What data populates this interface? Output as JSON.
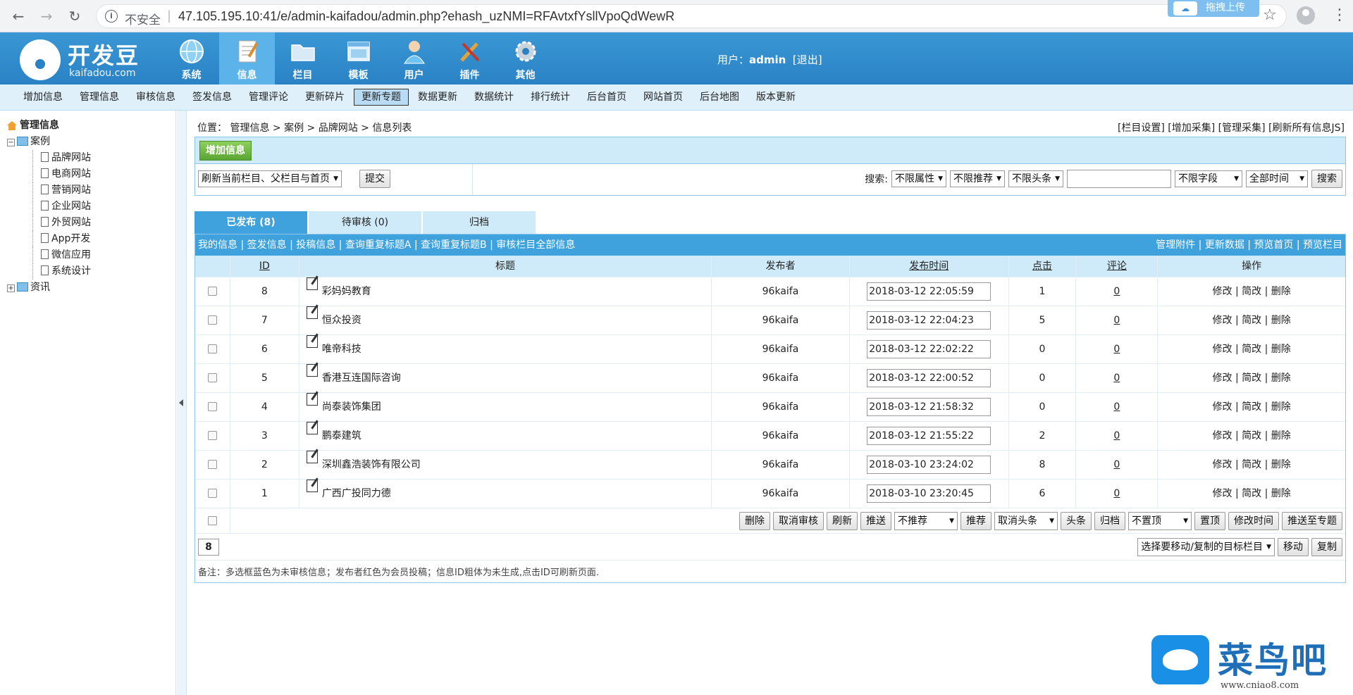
{
  "browser": {
    "insecure": "不安全",
    "url": "47.105.195.10:41/e/admin-kaifadou/admin.php?ehash_uzNMI=RFAvtxfYsllVpoQdWewR",
    "upload": "拖拽上传"
  },
  "header": {
    "logo_title": "开发豆",
    "logo_sub": "kaifadou.com",
    "modules": [
      {
        "label": "系统",
        "icon": "globe-icon"
      },
      {
        "label": "信息",
        "icon": "notepad-icon"
      },
      {
        "label": "栏目",
        "icon": "folder-icon"
      },
      {
        "label": "模板",
        "icon": "window-icon"
      },
      {
        "label": "用户",
        "icon": "user-icon"
      },
      {
        "label": "插件",
        "icon": "tools-icon"
      },
      {
        "label": "其他",
        "icon": "gear-icon"
      }
    ],
    "user_prefix": "用户：",
    "user_name": "admin",
    "logout": "[退出]"
  },
  "quicknav": [
    "增加信息",
    "管理信息",
    "审核信息",
    "签发信息",
    "管理评论",
    "更新碎片",
    "更新专题",
    "数据更新",
    "数据统计",
    "排行统计",
    "后台首页",
    "网站首页",
    "后台地图",
    "版本更新"
  ],
  "sidebar": {
    "root": "管理信息",
    "folder": "案例",
    "leaves": [
      "品牌网站",
      "电商网站",
      "营销网站",
      "企业网站",
      "外贸网站",
      "App开发",
      "微信应用",
      "系统设计"
    ],
    "folder2": "资讯"
  },
  "main": {
    "crumbs": "位置： 管理信息 > 案例 > 品牌网站 > 信息列表",
    "top_links": "[栏目设置] [增加采集] [管理采集] [刷新所有信息JS]",
    "add_btn": "增加信息",
    "refresh_select": "刷新当前栏目、父栏目与首页",
    "submit": "提交",
    "search_label": "搜索:",
    "filters": [
      "不限属性",
      "不限推荐",
      "不限头条"
    ],
    "field_select": "不限字段",
    "time_select": "全部时间",
    "search_btn": "搜索",
    "tabs": [
      "已发布 (8)",
      "待审核 (0)",
      "归档"
    ],
    "subbar_left": "我的信息 | 签发信息 | 投稿信息 | 查询重复标题A | 查询重复标题B | 审核栏目全部信息",
    "subbar_right": "管理附件 | 更新数据 | 预览首页 | 预览栏目",
    "columns": {
      "id": "ID",
      "title": "标题",
      "publisher": "发布者",
      "time": "发布时间",
      "clicks": "点击",
      "comments": "评论",
      "ops": "操作"
    },
    "ops_text": "修改 | 简改 | 删除",
    "rows": [
      {
        "id": "8",
        "title": "彩妈妈教育",
        "publisher": "96kaifa",
        "time": "2018-03-12 22:05:59",
        "clicks": "1",
        "comments": "0"
      },
      {
        "id": "7",
        "title": "恒众投资",
        "publisher": "96kaifa",
        "time": "2018-03-12 22:04:23",
        "clicks": "5",
        "comments": "0"
      },
      {
        "id": "6",
        "title": "唯帝科技",
        "publisher": "96kaifa",
        "time": "2018-03-12 22:02:22",
        "clicks": "0",
        "comments": "0"
      },
      {
        "id": "5",
        "title": "香港互连国际咨询",
        "publisher": "96kaifa",
        "time": "2018-03-12 22:00:52",
        "clicks": "0",
        "comments": "0"
      },
      {
        "id": "4",
        "title": "尚泰装饰集团",
        "publisher": "96kaifa",
        "time": "2018-03-12 21:58:32",
        "clicks": "0",
        "comments": "0"
      },
      {
        "id": "3",
        "title": "鹏泰建筑",
        "publisher": "96kaifa",
        "time": "2018-03-12 21:55:22",
        "clicks": "2",
        "comments": "0"
      },
      {
        "id": "2",
        "title": "深圳鑫浩装饰有限公司",
        "publisher": "96kaifa",
        "time": "2018-03-10 23:24:02",
        "clicks": "8",
        "comments": "0"
      },
      {
        "id": "1",
        "title": "广西广投同力德",
        "publisher": "96kaifa",
        "time": "2018-03-10 23:20:45",
        "clicks": "6",
        "comments": "0"
      }
    ],
    "actions": [
      "删除",
      "取消审核",
      "刷新",
      "推送"
    ],
    "recommend_select": "不推荐",
    "recommend_btn": "推荐",
    "headline_select": "取消头条",
    "actions2": [
      "头条",
      "归档"
    ],
    "top_select": "不置顶",
    "actions3": [
      "置顶",
      "修改时间",
      "推送至专题"
    ],
    "page_num": "8",
    "target_select": "选择要移动/复制的目标栏目",
    "move_btn": "移动",
    "copy_btn": "复制",
    "note": "备注：多选框蓝色为未审核信息；发布者红色为会员投稿；信息ID粗体为未生成,点击ID可刷新页面."
  },
  "watermark": {
    "text": "菜鸟吧",
    "url": "www.cniao8.com"
  }
}
